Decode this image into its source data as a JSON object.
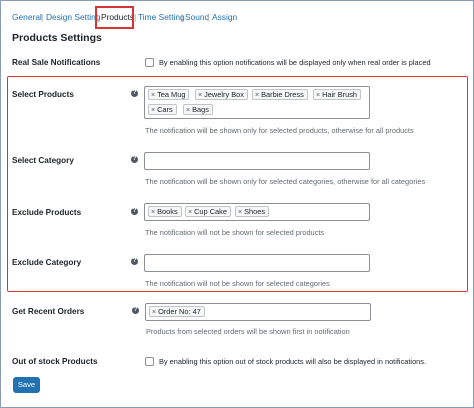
{
  "tabs": {
    "general": "General",
    "design": "Design Setting",
    "products": "Products",
    "time": "Time Setting",
    "sound": "Sound",
    "assign": "Assign",
    "separator": "|"
  },
  "section_title": "Products Settings",
  "real_sale": {
    "label": "Real Sale Notifications",
    "checkbox_text": "By enabling this option notifications will be displayed only when real order is placed"
  },
  "select_products": {
    "label": "Select Products",
    "tokens": [
      "Tea Mug",
      "Jewelry Box",
      "Barbie Dress",
      "Hair Brush",
      "Cars",
      "Bags"
    ],
    "description": "The notification will be shown only for selected products, otherwise for all products"
  },
  "select_category": {
    "label": "Select Category",
    "description": "The notification will be shown only for selected categories, otherwise for all categories"
  },
  "exclude_products": {
    "label": "Exclude Products",
    "tokens": [
      "Books",
      "Cup Cake",
      "Shoes"
    ],
    "description": "The notification will not be shown for selected products"
  },
  "exclude_category": {
    "label": "Exclude Category",
    "description": "The notification will not be shown for selected categories"
  },
  "recent_orders": {
    "label": "Get Recent Orders",
    "tokens": [
      "Order No: 47"
    ],
    "description": "Products from selected orders will be shown first in notification"
  },
  "out_of_stock": {
    "label": "Out of stock Products",
    "checkbox_text": "By enabling this option out of stock products will also be displayed in notifications."
  },
  "help_glyph": "?",
  "remove_glyph": "×",
  "save_label": "Save",
  "colors": {
    "link": "#2271b1",
    "highlight": "#d63638",
    "button": "#2271b1"
  }
}
